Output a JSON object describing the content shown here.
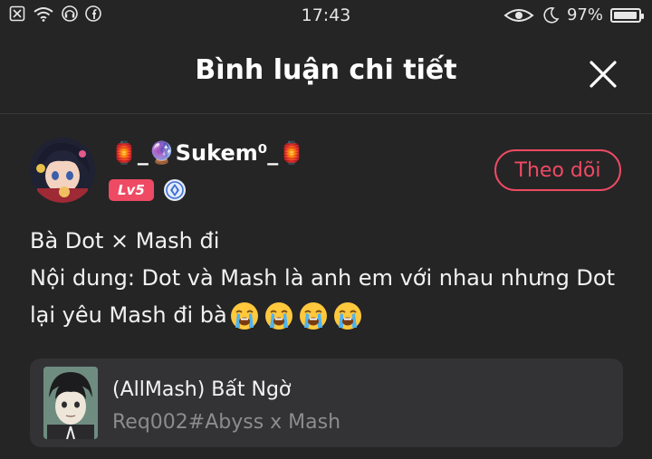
{
  "status_bar": {
    "time": "17:43",
    "battery_percent": "97%",
    "battery_level": 0.97,
    "left_icons": [
      "close-box-icon",
      "wifi-icon",
      "headphones-icon",
      "facebook-icon"
    ],
    "right_icons": [
      "eye-icon",
      "moon-icon",
      "battery-icon"
    ]
  },
  "header": {
    "title": "Bình luận chi tiết",
    "close_icon": "close-icon"
  },
  "comment": {
    "username": "🏮_🔮Sukem⁰_🏮",
    "level_badge": "Lv5",
    "follow_label": "Theo dõi",
    "lines": [
      "Bà Dot × Mash đi",
      "Nội dung: Dot và Mash là anh em với nhau nhưng Dot",
      "lại yêu Mash đi bà"
    ],
    "emoji_name": "loudly-crying-face-icon",
    "emoji_count": 4
  },
  "story_card": {
    "title": "(AllMash) Bất Ngờ",
    "subtitle": "Req002#Abyss x Mash"
  },
  "colors": {
    "background": "#252526",
    "accent": "#ee4a63",
    "card": "#333336"
  }
}
